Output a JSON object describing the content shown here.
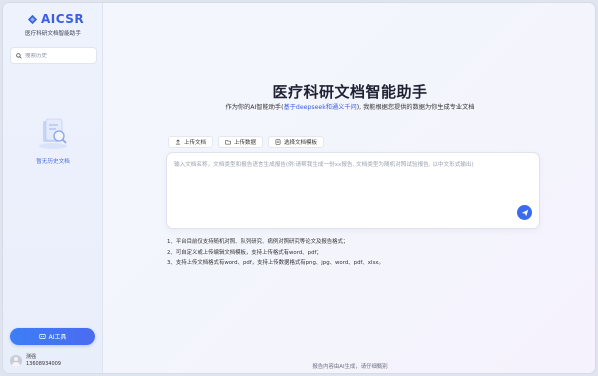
{
  "sidebar": {
    "logo_text": "AICSR",
    "subtitle": "医疗科研文档智能助手",
    "search_placeholder": "搜索历史",
    "empty_text": "暂无历史文档",
    "ai_tool_label": "AI工具",
    "user": {
      "name": "测强",
      "phone": "13608934009"
    }
  },
  "main": {
    "title": "医疗科研文档智能助手",
    "tagline_prefix": "作为你的AI智能助手(",
    "tagline_highlight": "基于deepseek和通义千问",
    "tagline_suffix": "), 我能根据您提供的数据为你生成专业文档",
    "tabs": [
      {
        "label": "上传文档",
        "icon": "upload-icon"
      },
      {
        "label": "上传数据",
        "icon": "folder-icon"
      },
      {
        "label": "选择文档模板",
        "icon": "template-icon"
      }
    ],
    "input_placeholder": "输入文档名称，文档类型和报告语言生成报告(例:请帮我生成一份xx报告, 文档类型为随机对照试验报告, 以中文形式输出)",
    "notes": [
      "1、平台目前仅支持随机对照、队列研究、病例对照研究等论文及报告格式；",
      "2、可自定义或上传编辑文档模板，支持上传格式有word、pdf；",
      "3、支持上传文档格式有word、pdf，支持上传数据格式有png、jpg、word、pdf、xlsx。"
    ],
    "footer_note": "报告内容由AI生成，请仔细甄别"
  },
  "colors": {
    "accent": "#3a5fe0",
    "button": "#3b6cf0"
  }
}
